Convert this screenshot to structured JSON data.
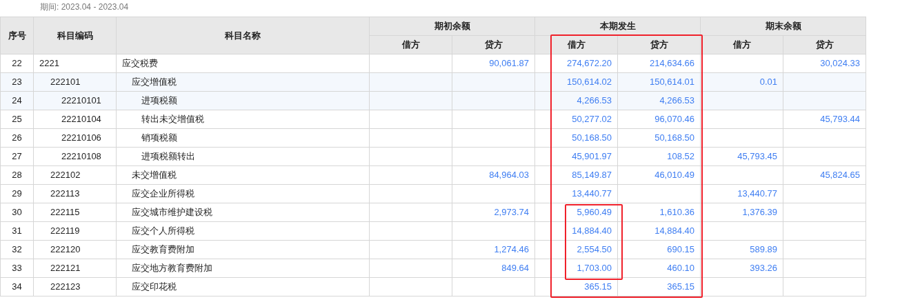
{
  "period": "期间:  2023.04 - 2023.04",
  "header": {
    "seq": "序号",
    "code": "科目编码",
    "name": "科目名称",
    "groups": [
      {
        "label": "期初余额",
        "highlighted": false,
        "debit": "借方",
        "credit": "贷方"
      },
      {
        "label": "本期发生",
        "highlighted": true,
        "debit": "借方",
        "credit": "贷方"
      },
      {
        "label": "期末余额",
        "highlighted": false,
        "debit": "借方",
        "credit": "贷方"
      }
    ]
  },
  "rows": [
    {
      "seq": "22",
      "code": "2221",
      "name": "应交税费",
      "shaded": false,
      "marked": false,
      "values": {
        "opening_credit": "90,061.87",
        "period_debit": "274,672.20",
        "period_credit": "214,634.66",
        "closing_credit": "30,024.33"
      },
      "children": [
        {
          "seq": "23",
          "code": "222101",
          "name": "应交增值税",
          "shaded": true,
          "marked": false,
          "values": {
            "period_debit": "150,614.02",
            "period_credit": "150,614.01",
            "closing_debit": "0.01"
          },
          "children": [
            {
              "seq": "24",
              "code": "22210101",
              "name": "进项税额",
              "shaded": true,
              "marked": false,
              "values": {
                "period_debit": "4,266.53",
                "period_credit": "4,266.53"
              }
            },
            {
              "seq": "25",
              "code": "22210104",
              "name": "转出未交增值税",
              "shaded": false,
              "marked": false,
              "values": {
                "period_debit": "50,277.02",
                "period_credit": "96,070.46",
                "closing_credit": "45,793.44"
              }
            },
            {
              "seq": "26",
              "code": "22210106",
              "name": "销项税额",
              "shaded": false,
              "marked": false,
              "values": {
                "period_debit": "50,168.50",
                "period_credit": "50,168.50"
              }
            },
            {
              "seq": "27",
              "code": "22210108",
              "name": "进项税额转出",
              "shaded": false,
              "marked": false,
              "values": {
                "period_debit": "45,901.97",
                "period_credit": "108.52",
                "closing_debit": "45,793.45"
              }
            }
          ]
        },
        {
          "seq": "28",
          "code": "222102",
          "name": "未交增值税",
          "shaded": false,
          "marked": false,
          "values": {
            "opening_credit": "84,964.03",
            "period_debit": "85,149.87",
            "period_credit": "46,010.49",
            "closing_credit": "45,824.65"
          }
        },
        {
          "seq": "29",
          "code": "222113",
          "name": "应交企业所得税",
          "shaded": false,
          "marked": false,
          "values": {
            "period_debit": "13,440.77",
            "closing_debit": "13,440.77"
          }
        },
        {
          "seq": "30",
          "code": "222115",
          "name": "应交城市维护建设税",
          "shaded": false,
          "marked": true,
          "values": {
            "opening_credit": "2,973.74",
            "period_debit": "5,960.49",
            "period_credit": "1,610.36",
            "closing_debit": "1,376.39"
          }
        },
        {
          "seq": "31",
          "code": "222119",
          "name": "应交个人所得税",
          "shaded": false,
          "marked": true,
          "values": {
            "period_debit": "14,884.40",
            "period_credit": "14,884.40"
          }
        },
        {
          "seq": "32",
          "code": "222120",
          "name": "应交教育费附加",
          "shaded": false,
          "marked": true,
          "values": {
            "opening_credit": "1,274.46",
            "period_debit": "2,554.50",
            "period_credit": "690.15",
            "closing_debit": "589.89"
          }
        },
        {
          "seq": "33",
          "code": "222121",
          "name": "应交地方教育费附加",
          "shaded": false,
          "marked": true,
          "values": {
            "opening_credit": "849.64",
            "period_debit": "1,703.00",
            "period_credit": "460.10",
            "closing_debit": "393.26"
          }
        },
        {
          "seq": "34",
          "code": "222123",
          "name": "应交印花税",
          "shaded": false,
          "marked": false,
          "values": {
            "period_debit": "365.15",
            "period_credit": "365.15"
          }
        }
      ]
    }
  ]
}
